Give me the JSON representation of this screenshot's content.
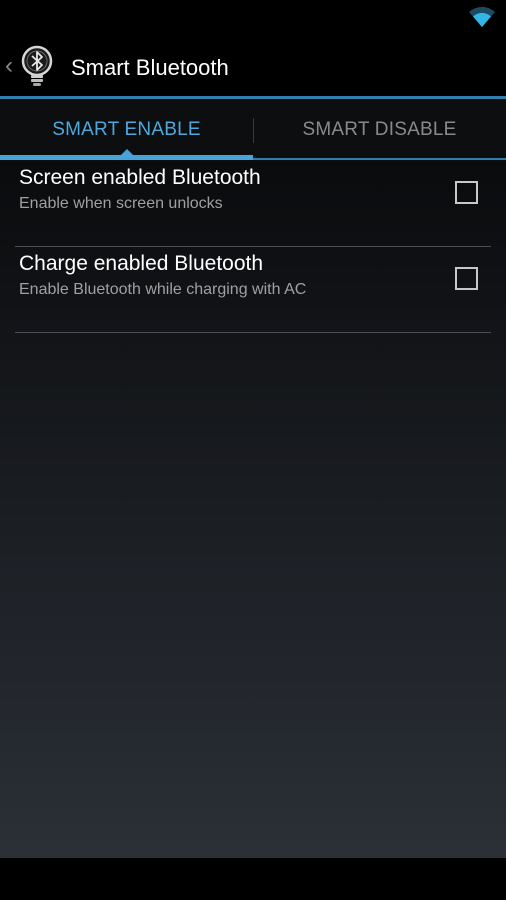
{
  "status_bar": {
    "wifi_icon": "wifi-icon",
    "accent_color": "#33b5e5"
  },
  "action_bar": {
    "back_glyph": "‹",
    "app_icon": "lightbulb-bluetooth-icon",
    "title": "Smart Bluetooth"
  },
  "tabs": [
    {
      "label": "SMART ENABLE",
      "selected": true
    },
    {
      "label": "SMART DISABLE",
      "selected": false
    }
  ],
  "preferences": [
    {
      "title": "Screen enabled Bluetooth",
      "summary": "Enable when screen unlocks",
      "checked": false
    },
    {
      "title": "Charge enabled Bluetooth",
      "summary": "Enable Bluetooth while charging with AC",
      "checked": false
    }
  ],
  "colors": {
    "accent": "#46a4db",
    "tab_selected_text": "#4ea8dc",
    "tab_unselected_text": "#8a8a8a"
  }
}
